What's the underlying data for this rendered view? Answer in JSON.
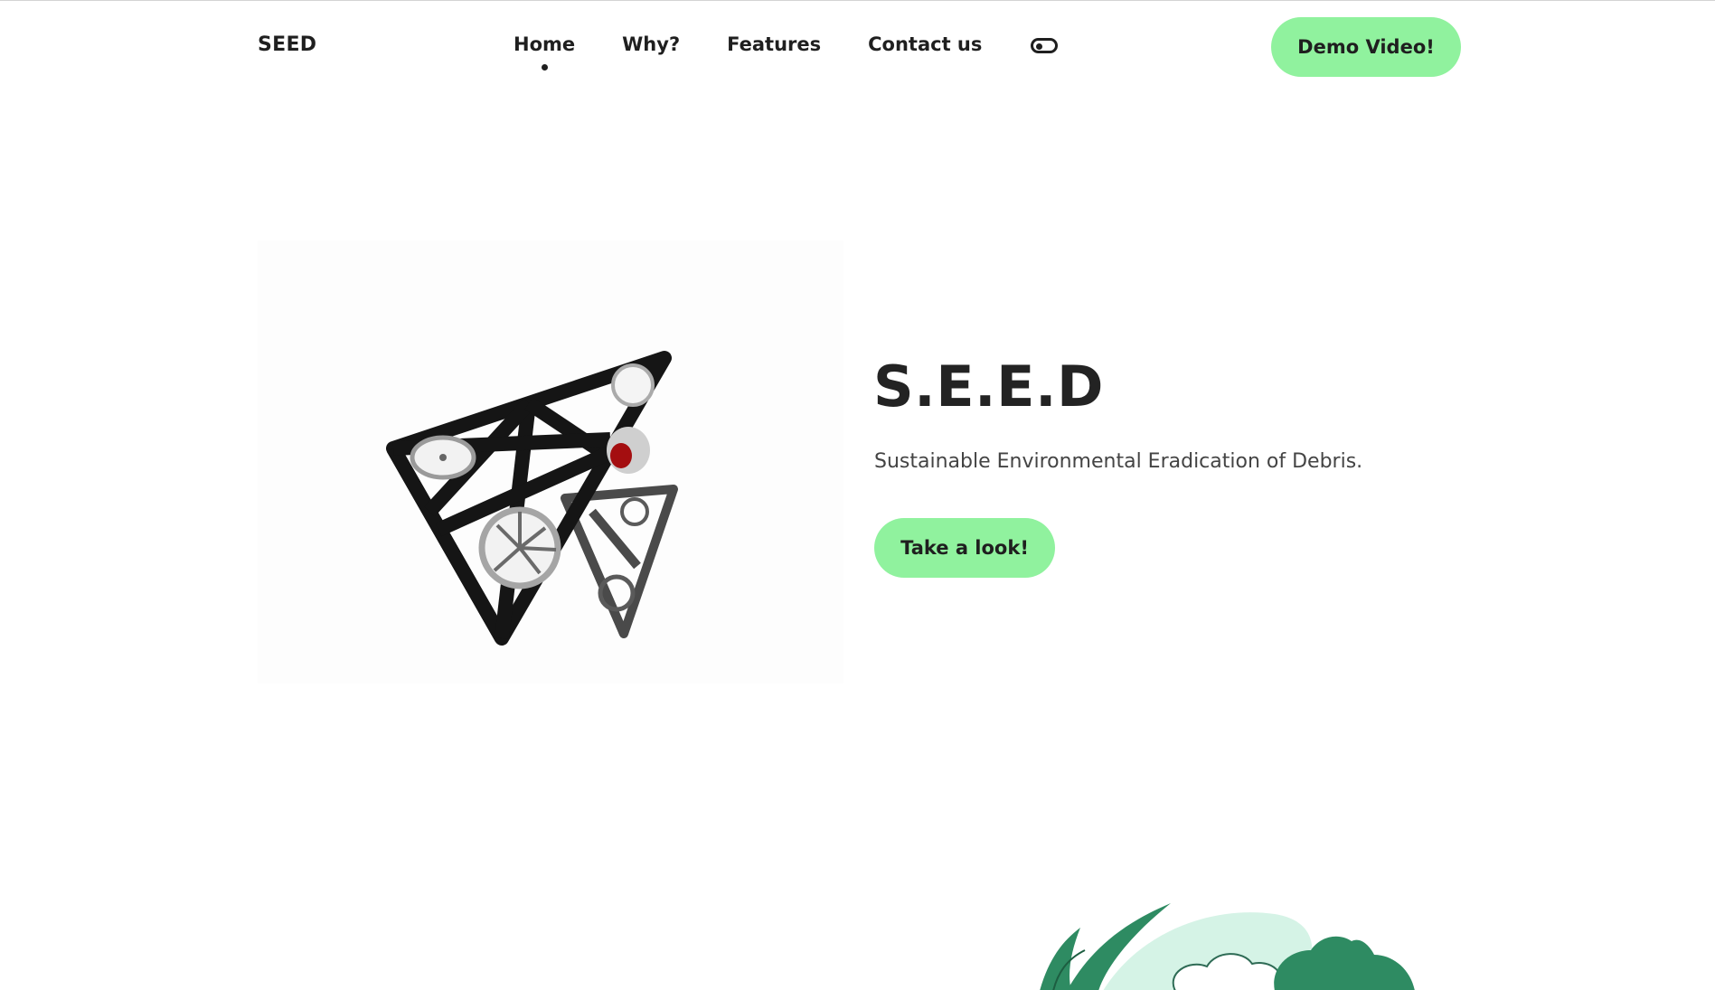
{
  "header": {
    "brand": "SEED",
    "nav": [
      {
        "label": "Home",
        "active": true
      },
      {
        "label": "Why?",
        "active": false
      },
      {
        "label": "Features",
        "active": false
      },
      {
        "label": "Contact us",
        "active": false
      }
    ],
    "theme_toggle_icon": "toggle-icon",
    "demo_button": "Demo Video!"
  },
  "hero": {
    "title": "S.E.E.D",
    "subtitle": "Sustainable Environmental Eradication of Debris.",
    "cta": "Take a look!",
    "image_icon": "drone-frame-illustration"
  },
  "footer_art": {
    "icon": "plants-illustration"
  },
  "colors": {
    "accent": "#90f29e",
    "text": "#1f1f1f",
    "subtext": "#444444",
    "plant_dark": "#2e8b62",
    "plant_light": "#d5f3e6"
  }
}
